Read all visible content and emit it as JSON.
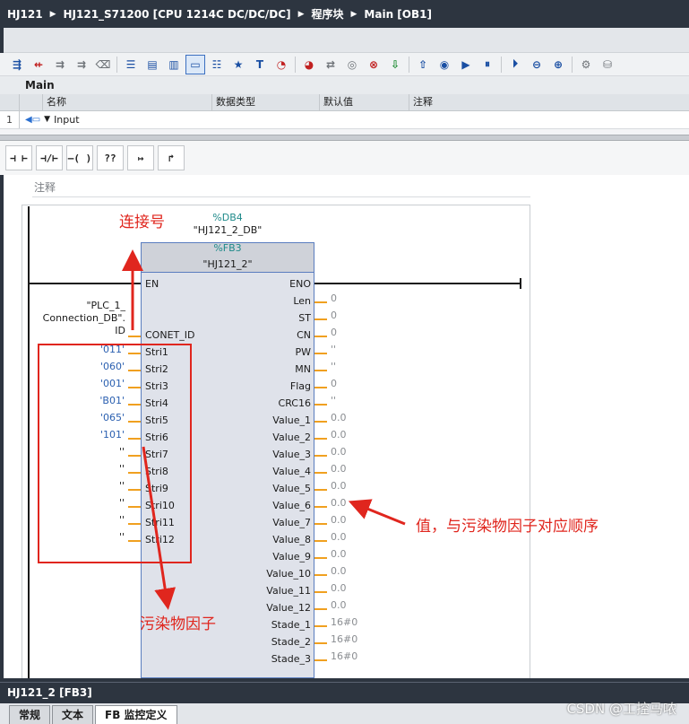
{
  "breadcrumb": {
    "items": [
      "HJ121",
      "HJ121_S71200 [CPU 1214C DC/DC/DC]",
      "程序块",
      "Main [OB1]"
    ],
    "separator": "▶"
  },
  "toolbar": {
    "icons": [
      "insert-network-icon",
      "delete-network-icon",
      "insert-row-icon",
      "add-row-icon",
      "eraser-icon",
      "absolute-operands-icon",
      "network-collapse-icon",
      "network-expand-icon",
      "comments-icon",
      "instruction-list-icon",
      "favorites-icon",
      "text-icon",
      "monitor-icon",
      "online-icon",
      "compare-icon",
      "watch-icon",
      "force-icon",
      "download-icon",
      "upload-icon",
      "stop-icon",
      "run-icon",
      "break-icon",
      "continue-icon",
      "disable-icon",
      "enable-icon",
      "settings-icon",
      "database-icon"
    ]
  },
  "interface": {
    "title": "Main",
    "columns": [
      "名称",
      "数据类型",
      "默认值",
      "注释"
    ],
    "rows": [
      {
        "num": "1",
        "name": "Input",
        "type": "",
        "default": "",
        "comment": ""
      }
    ]
  },
  "lad_toolbar": {
    "buttons": [
      "⊣ ⊢",
      "⊣/⊢",
      "–( )",
      "??",
      "↦",
      "↱"
    ]
  },
  "network": {
    "comment_label": "注释",
    "db_number": "%DB4",
    "db_name": "\"HJ121_2_DB\"",
    "fb_number": "%FB3",
    "fb_name": "\"HJ121_2\"",
    "conn_db": "\"PLC_1_\nConnection_DB\".\nID",
    "inputs": [
      {
        "pin": "EN",
        "arg": ""
      },
      {
        "pin": "CONET_ID",
        "arg": ""
      },
      {
        "pin": "Stri1",
        "arg": "'011'"
      },
      {
        "pin": "Stri2",
        "arg": "'060'"
      },
      {
        "pin": "Stri3",
        "arg": "'001'"
      },
      {
        "pin": "Stri4",
        "arg": "'B01'"
      },
      {
        "pin": "Stri5",
        "arg": "'065'"
      },
      {
        "pin": "Stri6",
        "arg": "'101'"
      },
      {
        "pin": "Stri7",
        "arg": "''"
      },
      {
        "pin": "Stri8",
        "arg": "''"
      },
      {
        "pin": "Stri9",
        "arg": "''"
      },
      {
        "pin": "Stri10",
        "arg": "''"
      },
      {
        "pin": "Stri11",
        "arg": "''"
      },
      {
        "pin": "Stri12",
        "arg": "''"
      }
    ],
    "outputs": [
      {
        "pin": "ENO",
        "val": ""
      },
      {
        "pin": "Len",
        "val": "0"
      },
      {
        "pin": "ST",
        "val": "0"
      },
      {
        "pin": "CN",
        "val": "0"
      },
      {
        "pin": "PW",
        "val": "''"
      },
      {
        "pin": "MN",
        "val": "''"
      },
      {
        "pin": "Flag",
        "val": "0"
      },
      {
        "pin": "CRC16",
        "val": "''"
      },
      {
        "pin": "Value_1",
        "val": "0.0"
      },
      {
        "pin": "Value_2",
        "val": "0.0"
      },
      {
        "pin": "Value_3",
        "val": "0.0"
      },
      {
        "pin": "Value_4",
        "val": "0.0"
      },
      {
        "pin": "Value_5",
        "val": "0.0"
      },
      {
        "pin": "Value_6",
        "val": "0.0"
      },
      {
        "pin": "Value_7",
        "val": "0.0"
      },
      {
        "pin": "Value_8",
        "val": "0.0"
      },
      {
        "pin": "Value_9",
        "val": "0.0"
      },
      {
        "pin": "Value_10",
        "val": "0.0"
      },
      {
        "pin": "Value_11",
        "val": "0.0"
      },
      {
        "pin": "Value_12",
        "val": "0.0"
      },
      {
        "pin": "Stade_1",
        "val": "16#0"
      },
      {
        "pin": "Stade_2",
        "val": "16#0"
      },
      {
        "pin": "Stade_3",
        "val": "16#0"
      }
    ]
  },
  "annotations": {
    "connection": "连接号",
    "values": "值，与污染物因子对应顺序",
    "pollutants": "污染物因子",
    "color": "#e0261e"
  },
  "bottom": {
    "title": "HJ121_2 [FB3]",
    "tabs": [
      "常规",
      "文本",
      "FB 监控定义"
    ],
    "watermark": "CSDN @工控马哝"
  }
}
